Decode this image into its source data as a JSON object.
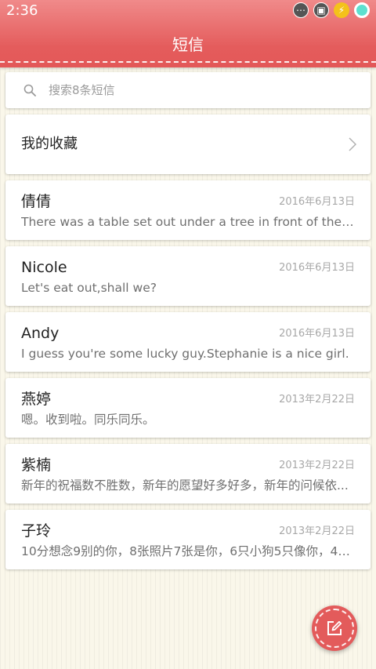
{
  "status_bar": {
    "time": "2:36",
    "icons": [
      "more-icon",
      "screenshot-icon",
      "charging-icon",
      "ring-icon"
    ]
  },
  "header": {
    "title": "短信",
    "color": "#e35b5b"
  },
  "search": {
    "placeholder": "搜索8条短信"
  },
  "favorites": {
    "label": "我的收藏"
  },
  "messages": [
    {
      "name": "倩倩",
      "date": "2016年6月13日",
      "preview": "There was a table set out under a tree in front of the hous"
    },
    {
      "name": "Nicole",
      "date": "2016年6月13日",
      "preview": "Let's eat out,shall we?"
    },
    {
      "name": "Andy",
      "date": "2016年6月13日",
      "preview": "I guess you're some lucky guy.Stephanie is a nice girl."
    },
    {
      "name": "燕婷",
      "date": "2013年2月22日",
      "preview": "嗯。收到啦。同乐同乐。"
    },
    {
      "name": "紫楠",
      "date": "2013年2月22日",
      "preview": "新年的祝福数不胜数，新年的愿望好多好多，新年的问候依..."
    },
    {
      "name": "子玲",
      "date": "2013年2月22日",
      "preview": "10分想念9别的你，8张照片7张是你，6只小狗5只像你，4根..."
    }
  ],
  "compose_button": {
    "icon": "compose-icon"
  }
}
